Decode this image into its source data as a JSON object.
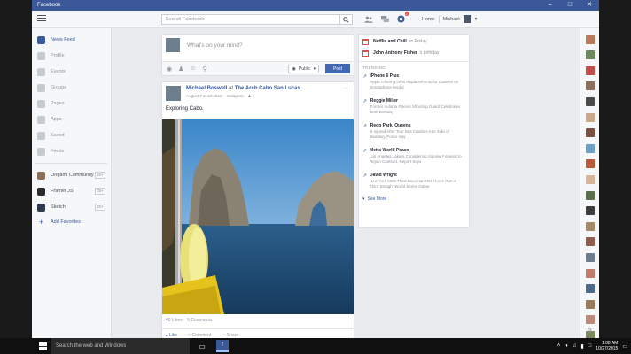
{
  "window": {
    "title": "Facebook"
  },
  "topbar": {
    "search_placeholder": "Search Facebook",
    "home_label": "Home",
    "user_label": "Michael",
    "notification_count": "1"
  },
  "nav": {
    "items": [
      {
        "label": "News Feed",
        "icon": "news-feed-icon",
        "active": true
      },
      {
        "label": "Profile",
        "icon": "profile-icon"
      },
      {
        "label": "Events",
        "icon": "events-icon"
      },
      {
        "label": "Groups",
        "icon": "groups-icon"
      },
      {
        "label": "Pages",
        "icon": "pages-icon"
      },
      {
        "label": "Apps",
        "icon": "apps-icon"
      },
      {
        "label": "Saved",
        "icon": "saved-icon"
      },
      {
        "label": "Feeds",
        "icon": "feeds-icon"
      }
    ],
    "favorites": [
      {
        "label": "Origami Community",
        "count": "20+",
        "color": "#8a6f5a"
      },
      {
        "label": "Framer JS",
        "count": "20+",
        "color": "#2b2b2b"
      },
      {
        "label": "Sketch",
        "count": "20+",
        "color": "#2d3a4d"
      }
    ],
    "add_favorites_label": "Add Favorites"
  },
  "composer": {
    "placeholder": "What's on your mind?",
    "privacy_label": "Public",
    "post_label": "Post"
  },
  "post": {
    "author": "Michael Boswell",
    "at_word": "at",
    "place": "The Arch Cabo San Lucas",
    "meta": "August 7 at 10:40am · Instagram · ",
    "text": "Exploring Cabo.",
    "likes": "40 Likes",
    "comments": "5 Comments",
    "like_label": "Like",
    "comment_label": "Comment",
    "share_label": "Share"
  },
  "birthdays": [
    {
      "name": "Netflix and Chill",
      "suffix": "on Friday",
      "color": "#e04b4b"
    },
    {
      "name": "John Anthony Fisher",
      "suffix": "'s birthday",
      "color": "#e04b4b"
    }
  ],
  "trending": {
    "heading": "TRENDING",
    "items": [
      {
        "title": "iPhone 6 Plus",
        "desc": "Apple Offering Lens Replacements for Camera on Smartphone Model"
      },
      {
        "title": "Reggie Miller",
        "desc": "Former Indiana Pacers Shooting Guard Celebrates 50th Birthday"
      },
      {
        "title": "Rego Park, Queens",
        "desc": "6 Injured After Tour Bus Crashes Into Side of Building, Police Say"
      },
      {
        "title": "Metta World Peace",
        "desc": "Los Angeles Lakers Considering Signing Forward to Rejoin Contract, Report Says"
      },
      {
        "title": "David Wright",
        "desc": "New York Mets Third Baseman Hits Home Run in Third Straight World Series Game"
      }
    ],
    "see_more_label": "See More"
  },
  "chat_avatars": [
    "#b97a5c",
    "#6c8a5e",
    "#c14d4d",
    "#8c6f5a",
    "#4a4a4a",
    "#caa98a",
    "#7a5040",
    "#6aa1c4",
    "#b85a3a",
    "#d8b59a",
    "#5b6f4a",
    "#3d3d3d",
    "#a58a6a",
    "#8f5d4b",
    "#6d7d8d",
    "#c07b6a",
    "#4f6b8a",
    "#9a7a5a",
    "#bb8a7a",
    "#7a8a5a"
  ],
  "taskbar": {
    "search_placeholder": "Search the web and Windows",
    "time": "1:08 AM",
    "date": "10/27/2015"
  }
}
